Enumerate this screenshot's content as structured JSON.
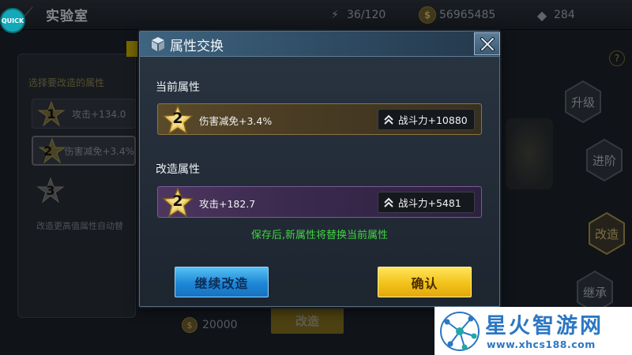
{
  "top_bar": {
    "quick_label": "QUICK",
    "screen_title": "实验室",
    "energy": "36/120",
    "gold": "56965485",
    "diamond": "284"
  },
  "background": {
    "left_heading": "选择要改造的属性",
    "left_rows": [
      {
        "rank": "1",
        "text": "攻击+134.0"
      },
      {
        "rank": "2",
        "text": "伤害减免+3.4%"
      },
      {
        "rank": "3",
        "text": ""
      }
    ],
    "left_note": "改造更高值属性自动替",
    "side_buttons": [
      "升级",
      "进阶",
      "改造",
      "继承"
    ],
    "cost_value": "20000",
    "modify_button": "改造",
    "help_icon": "?"
  },
  "dialog": {
    "title": "属性交换",
    "current_label": "当前属性",
    "current": {
      "rank": "2",
      "attribute": "伤害减免+3.4%",
      "power": "战斗力+10880"
    },
    "modified_label": "改造属性",
    "modified": {
      "rank": "2",
      "attribute": "攻击+182.7",
      "power": "战斗力+5481"
    },
    "notice": "保存后,新属性将替换当前属性",
    "continue_button": "继续改造",
    "confirm_button": "确认"
  },
  "watermark": {
    "name": "星火智游网",
    "url": "www.xhcs188.com"
  },
  "colors": {
    "notice_green": "#3fd43f",
    "continue_blue": "#1e87d6",
    "confirm_yellow": "#f2c21a",
    "current_bar": "#5a4a2a",
    "modified_bar": "#4d3660",
    "watermark_blue": "#2c77c4"
  },
  "icons": {
    "title": "cube-icon",
    "close": "close-icon",
    "power": "double-chevron-up-icon",
    "rank": "star-badge-icon"
  }
}
